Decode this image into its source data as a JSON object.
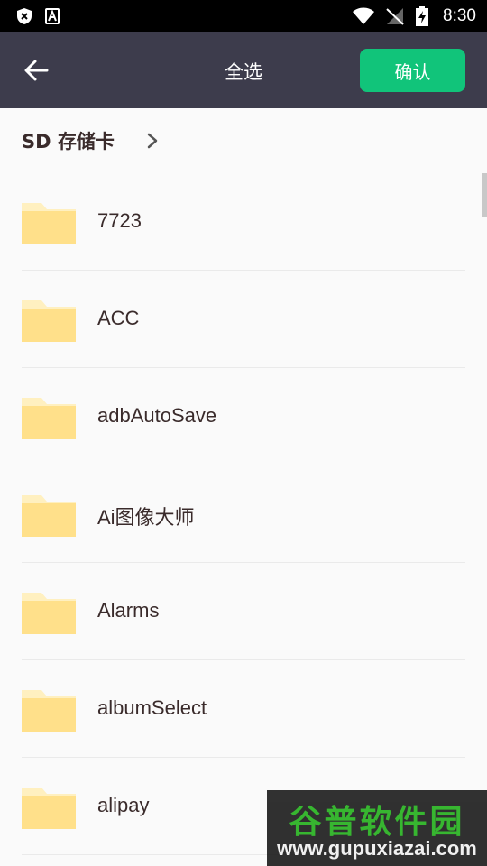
{
  "status_bar": {
    "time": "8:30"
  },
  "toolbar": {
    "title": "全选",
    "confirm_label": "确认"
  },
  "breadcrumb": {
    "label": "SD 存储卡"
  },
  "folders": [
    {
      "name": "7723"
    },
    {
      "name": "ACC"
    },
    {
      "name": "adbAutoSave"
    },
    {
      "name": "Ai图像大师"
    },
    {
      "name": "Alarms"
    },
    {
      "name": "albumSelect"
    },
    {
      "name": "alipay"
    }
  ],
  "watermark": {
    "title": "谷普软件园",
    "url": "www.gupuxiazai.com"
  },
  "colors": {
    "toolbar_bg": "#3d3c4c",
    "accent": "#11c47a",
    "folder": "#ffe08a"
  }
}
